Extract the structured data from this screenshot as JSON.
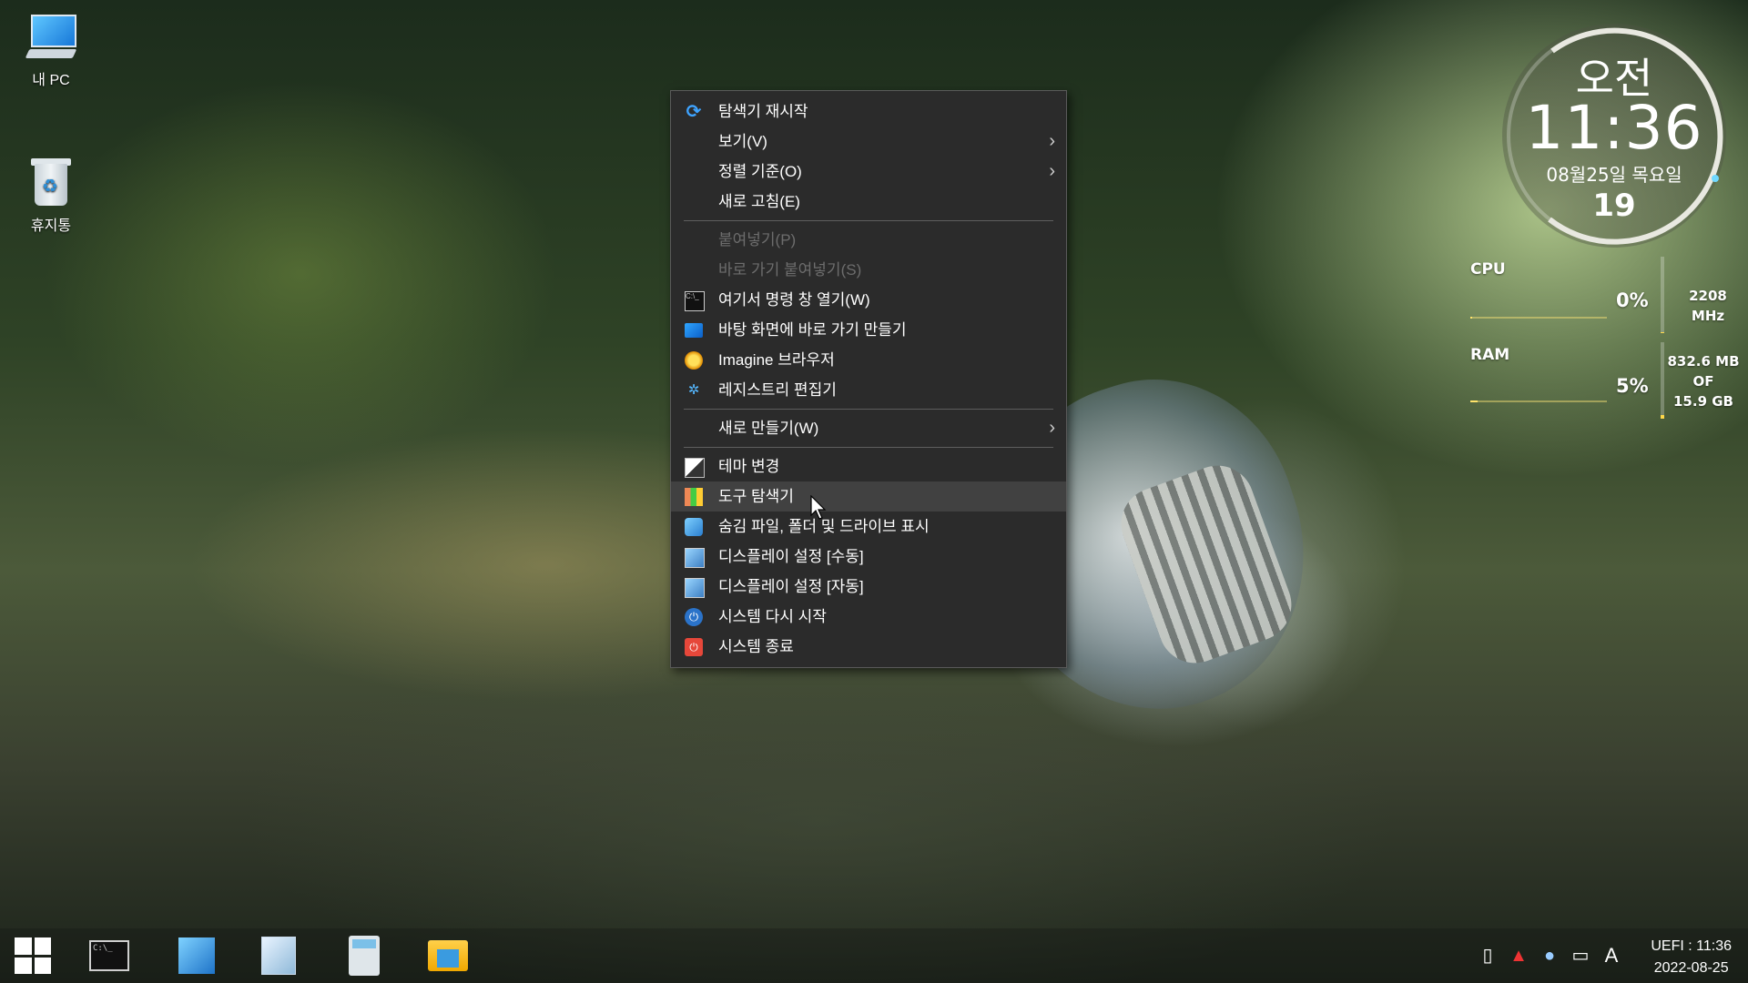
{
  "desktop": {
    "icons": [
      {
        "label": "내 PC",
        "icon": "computer-icon"
      },
      {
        "label": "휴지통",
        "icon": "recycle-bin-icon"
      }
    ]
  },
  "context_menu": {
    "items": [
      {
        "label": "탐색기 재시작",
        "icon": "refresh-icon",
        "enabled": true
      },
      {
        "label": "보기(V)",
        "submenu": true,
        "enabled": true
      },
      {
        "label": "정렬 기준(O)",
        "submenu": true,
        "enabled": true
      },
      {
        "label": "새로 고침(E)",
        "enabled": true
      },
      {
        "label": "붙여넣기(P)",
        "enabled": false
      },
      {
        "label": "바로 가기 붙여넣기(S)",
        "enabled": false
      },
      {
        "label": "여기서 명령 창 열기(W)",
        "icon": "command-prompt-icon",
        "enabled": true
      },
      {
        "label": "바탕 화면에 바로 가기 만들기",
        "icon": "desktop-icon",
        "enabled": true
      },
      {
        "label": "Imagine 브라우저",
        "icon": "imagine-icon",
        "enabled": true
      },
      {
        "label": "레지스트리 편집기",
        "icon": "registry-icon",
        "enabled": true
      },
      {
        "label": "새로 만들기(W)",
        "submenu": true,
        "enabled": true
      },
      {
        "label": "테마 변경",
        "icon": "theme-icon",
        "enabled": true
      },
      {
        "label": "도구 탐색기",
        "icon": "tools-icon",
        "enabled": true,
        "highlighted": true
      },
      {
        "label": "숨김 파일, 폴더 및 드라이브 표시",
        "icon": "hidden-files-icon",
        "enabled": true
      },
      {
        "label": "디스플레이 설정 [수동]",
        "icon": "display-icon",
        "enabled": true
      },
      {
        "label": "디스플레이 설정 [자동]",
        "icon": "display-auto-icon",
        "enabled": true
      },
      {
        "label": "시스템 다시 시작",
        "icon": "restart-icon",
        "enabled": true
      },
      {
        "label": "시스템 종료",
        "icon": "power-icon",
        "enabled": true
      }
    ]
  },
  "clock_widget": {
    "ampm": "오전",
    "time": "11:36",
    "date": "08월25일 목요일",
    "seconds": "19"
  },
  "system_monitor": {
    "cpu": {
      "label": "CPU",
      "percent": "0%",
      "percent_value": 0,
      "freq": "2208 MHz"
    },
    "ram": {
      "label": "RAM",
      "percent": "5%",
      "percent_value": 5,
      "used": "832.6 MB",
      "of": "OF",
      "total": "15.9 GB"
    }
  },
  "taskbar": {
    "apps": [
      {
        "name": "start-button"
      },
      {
        "name": "command-prompt"
      },
      {
        "name": "registry-editor"
      },
      {
        "name": "notepad"
      },
      {
        "name": "calculator"
      },
      {
        "name": "file-explorer"
      }
    ],
    "tray": {
      "ime": "A",
      "clock_line1": "UEFI : 11:36",
      "clock_line2": "2022-08-25"
    }
  },
  "colors": {
    "menu_bg": "#2b2b2b",
    "menu_hover": "#414141",
    "accent_blue": "#3ea3ff"
  }
}
